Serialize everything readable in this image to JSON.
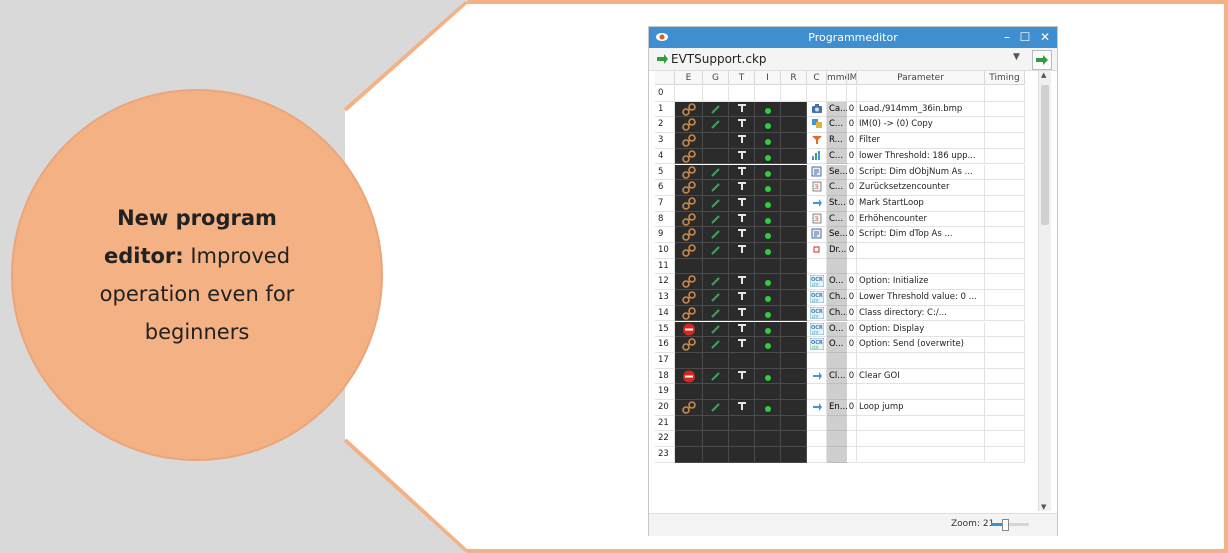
{
  "callout": {
    "title_bold": "New program editor:",
    "title_rest": " Improved operation even for beginners"
  },
  "window": {
    "title": "Programmeditor",
    "file": "EVTSupport.ckp",
    "zoom_label": "Zoom: 21",
    "zoom_level": 0.35
  },
  "columns": [
    "",
    "E",
    "G",
    "T",
    "I",
    "R",
    "C",
    "mme",
    "IM",
    "Parameter",
    "Timing"
  ],
  "rows": [
    {
      "n": "0",
      "e": "",
      "g": false,
      "t": false,
      "i": false,
      "c": "",
      "cmd": "",
      "im": "",
      "param": "",
      "dark": false
    },
    {
      "n": "1",
      "e": "link",
      "g": true,
      "t": true,
      "i": true,
      "c": "camera",
      "cmd": "Ca...",
      "im": "0",
      "param": "Load./914mm_36in.bmp",
      "dark": true
    },
    {
      "n": "2",
      "e": "link",
      "g": true,
      "t": true,
      "i": true,
      "c": "copy",
      "cmd": "C...",
      "im": "0",
      "param": "IM(0) -> (0)  Copy",
      "dark": true
    },
    {
      "n": "3",
      "e": "link",
      "g": false,
      "t": true,
      "i": true,
      "c": "filter",
      "cmd": "R...",
      "im": "0",
      "param": "Filter",
      "dark": true
    },
    {
      "n": "4",
      "e": "link",
      "g": false,
      "t": true,
      "i": true,
      "c": "threshold",
      "cmd": "C...",
      "im": "0",
      "param": "lower Threshold: 186 upp...",
      "dark": true
    },
    {
      "n": "5",
      "e": "link",
      "g": true,
      "t": true,
      "i": true,
      "c": "script",
      "cmd": "Se...",
      "im": "0",
      "param": "Script: Dim dObjNum As ...",
      "dark": true
    },
    {
      "n": "6",
      "e": "link",
      "g": true,
      "t": true,
      "i": true,
      "c": "counter",
      "cmd": "C...",
      "im": "0",
      "param": "Zurücksetzencounter",
      "dark": true
    },
    {
      "n": "7",
      "e": "link",
      "g": true,
      "t": true,
      "i": true,
      "c": "loop",
      "cmd": "St...",
      "im": "0",
      "param": "Mark StartLoop",
      "dark": true
    },
    {
      "n": "8",
      "e": "link",
      "g": true,
      "t": true,
      "i": true,
      "c": "counter",
      "cmd": "C...",
      "im": "0",
      "param": "Erhöhencounter",
      "dark": true
    },
    {
      "n": "9",
      "e": "link",
      "g": true,
      "t": true,
      "i": true,
      "c": "script",
      "cmd": "Se...",
      "im": "0",
      "param": "Script: Dim dTop As ...",
      "dark": true
    },
    {
      "n": "10",
      "e": "link",
      "g": true,
      "t": true,
      "i": true,
      "c": "draw",
      "cmd": "Dr...",
      "im": "0",
      "param": "",
      "dark": true
    },
    {
      "n": "11",
      "e": "",
      "g": false,
      "t": false,
      "i": false,
      "c": "",
      "cmd": "",
      "im": "",
      "param": "",
      "dark": true
    },
    {
      "n": "12",
      "e": "link",
      "g": true,
      "t": true,
      "i": true,
      "c": "ocr",
      "cmd": "O...",
      "im": "0",
      "param": "Option: Initialize",
      "dark": true
    },
    {
      "n": "13",
      "e": "link",
      "g": true,
      "t": true,
      "i": true,
      "c": "ocr",
      "cmd": "Ch...",
      "im": "0",
      "param": "Lower Threshold value: 0 ...",
      "dark": true
    },
    {
      "n": "14",
      "e": "link",
      "g": true,
      "t": true,
      "i": true,
      "c": "ocr",
      "cmd": "Ch...",
      "im": "0",
      "param": "Class directory: C:/...",
      "dark": true
    },
    {
      "n": "15",
      "e": "stop",
      "g": true,
      "t": true,
      "i": true,
      "c": "ocr",
      "cmd": "O...",
      "im": "0",
      "param": "Option: Display",
      "dark": true
    },
    {
      "n": "16",
      "e": "link",
      "g": true,
      "t": true,
      "i": true,
      "c": "ocr",
      "cmd": "O...",
      "im": "0",
      "param": "Option: Send  (overwrite)",
      "dark": true
    },
    {
      "n": "17",
      "e": "",
      "g": false,
      "t": false,
      "i": false,
      "c": "",
      "cmd": "",
      "im": "",
      "param": "",
      "dark": true
    },
    {
      "n": "18",
      "e": "stop",
      "g": true,
      "t": true,
      "i": true,
      "c": "loop",
      "cmd": "Cl...",
      "im": "0",
      "param": "Clear GOI",
      "dark": true
    },
    {
      "n": "19",
      "e": "",
      "g": false,
      "t": false,
      "i": false,
      "c": "",
      "cmd": "",
      "im": "",
      "param": "",
      "dark": true
    },
    {
      "n": "20",
      "e": "link",
      "g": true,
      "t": true,
      "i": true,
      "c": "loop",
      "cmd": "En...",
      "im": "0",
      "param": "Loop jump",
      "dark": true
    },
    {
      "n": "21",
      "e": "",
      "g": false,
      "t": false,
      "i": false,
      "c": "",
      "cmd": "",
      "im": "",
      "param": "",
      "dark": true
    },
    {
      "n": "22",
      "e": "",
      "g": false,
      "t": false,
      "i": false,
      "c": "",
      "cmd": "",
      "im": "",
      "param": "",
      "dark": true
    },
    {
      "n": "23",
      "e": "",
      "g": false,
      "t": false,
      "i": false,
      "c": "",
      "cmd": "",
      "im": "",
      "param": "",
      "dark": true
    }
  ],
  "colors": {
    "callout_fill": "#f4b183",
    "callout_border": "#e8a070",
    "titlebar": "#3e8ed0",
    "dark_cell": "#2b2b2b",
    "status_green": "#2ecc40",
    "stop_red": "#d9261c"
  }
}
